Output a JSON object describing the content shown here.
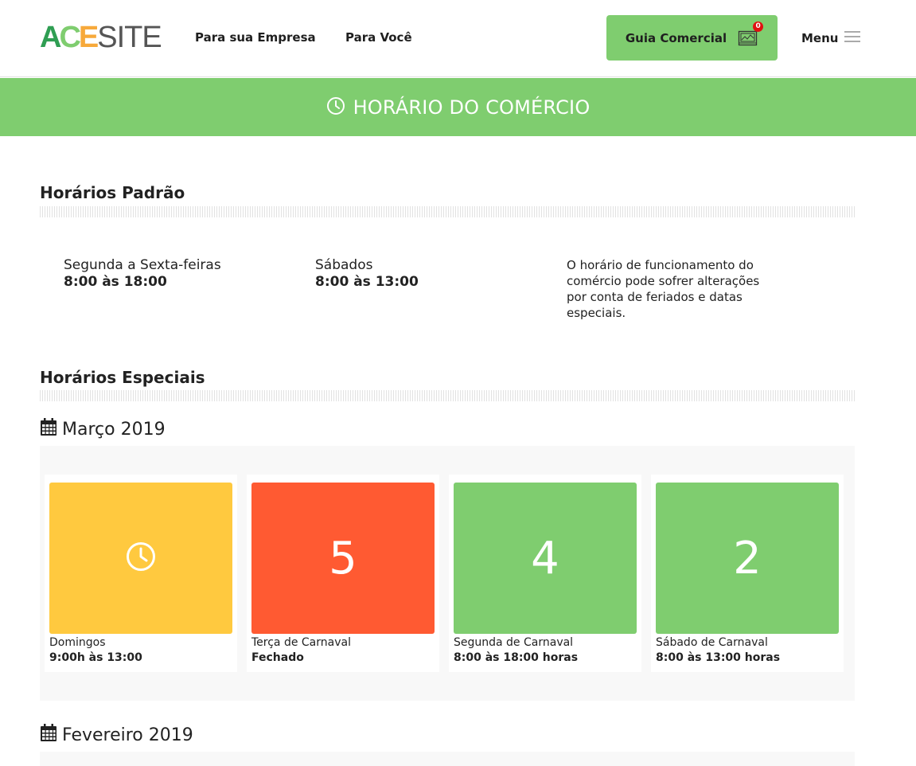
{
  "header": {
    "logo_ac": "ACE",
    "logo_site": "SITE",
    "nav": [
      "Para sua Empresa",
      "Para Você"
    ],
    "guia_label": "Guia Comercial",
    "cart_count": "0",
    "menu_label": "Menu"
  },
  "banner": {
    "title": "HORÁRIO DO COMÉRCIO"
  },
  "padrao": {
    "title": "Horários Padrão",
    "blocks": [
      {
        "days": "Segunda a Sexta-feiras",
        "hours": "8:00 às 18:00"
      },
      {
        "days": "Sábados",
        "hours": "8:00 às 13:00"
      }
    ],
    "note": "O horário de funcionamento do comércio pode sofrer alterações por conta de feriados e datas especiais."
  },
  "especiais": {
    "title": "Horários Especiais",
    "months": [
      {
        "name": "Março 2019",
        "cards": [
          {
            "kind": "clock",
            "number": "",
            "label": "Domingos",
            "hours": "9:00h às 13:00",
            "color": "#ffc93f"
          },
          {
            "kind": "day",
            "number": "5",
            "label": "Terça de Carnaval",
            "hours": "Fechado",
            "color": "#ff5a32"
          },
          {
            "kind": "day",
            "number": "4",
            "label": "Segunda de Carnaval",
            "hours": "8:00 às 18:00 horas",
            "color": "#7fcd6f"
          },
          {
            "kind": "day",
            "number": "2",
            "label": "Sábado de Carnaval",
            "hours": "8:00 às 13:00 horas",
            "color": "#7fcd6f"
          }
        ]
      },
      {
        "name": "Fevereiro 2019",
        "cards": []
      }
    ]
  },
  "colors": {
    "brand_green": "#7fcd6f",
    "yellow": "#ffc93f",
    "orange_red": "#ff5a32",
    "badge_red": "#e01010"
  },
  "icons": [
    "clock-icon",
    "calendar-icon",
    "cart-icon",
    "hamburger-icon"
  ]
}
